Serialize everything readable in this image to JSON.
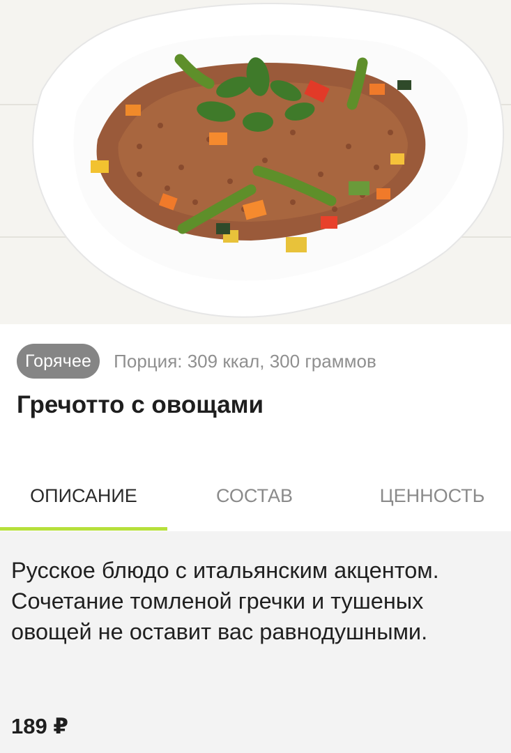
{
  "product": {
    "image_alt": "Гречотто с овощами",
    "badge": "Горячее",
    "portion": "Порция: 309 ккал, 300 граммов",
    "title": "Гречотто с овощами",
    "description": "Русское блюдо с итальянским акцентом. Сочетание томленой гречки и тушеных овощей не оставит вас равнодушными.",
    "price": "189 ₽"
  },
  "tabs": [
    {
      "label": "Описание",
      "active": true
    },
    {
      "label": "Состав",
      "active": false
    },
    {
      "label": "Ценность",
      "active": false
    }
  ],
  "colors": {
    "accent": "#b6e03b",
    "badge_bg": "#858585",
    "muted_text": "#8f8f8f"
  }
}
